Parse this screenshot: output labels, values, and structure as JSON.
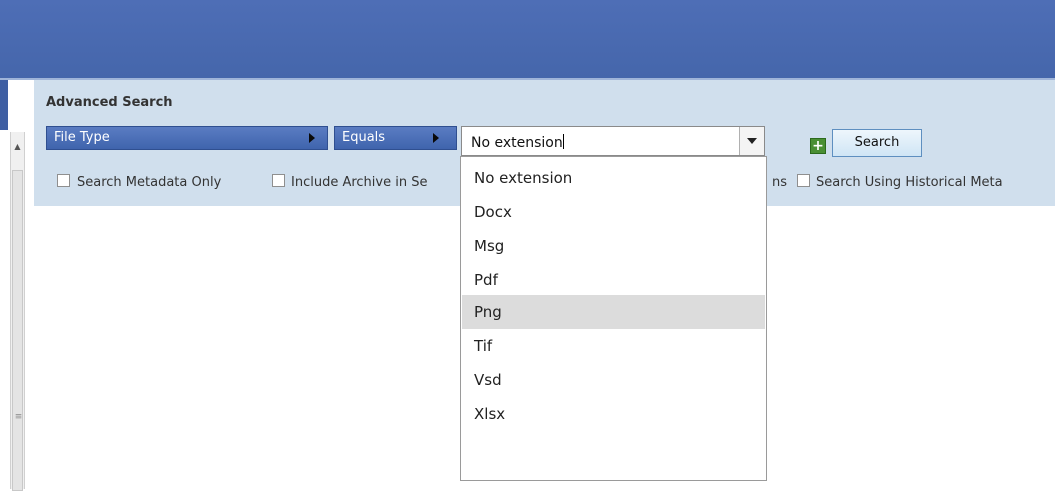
{
  "header": {
    "title": "Advanced Search"
  },
  "criteria": {
    "field_label": "File Type",
    "operator_label": "Equals",
    "value": "No extension",
    "add_symbol": "+",
    "search_label": "Search"
  },
  "options": [
    {
      "label": "Search Metadata Only",
      "checked": false
    },
    {
      "label": "Include Archive in Se",
      "checked": false
    },
    {
      "label": "ns",
      "checked": false
    },
    {
      "label": "Search Using Historical Meta",
      "checked": false
    }
  ],
  "dropdown": {
    "items": [
      "No extension",
      "Docx",
      "Msg",
      "Pdf",
      "Png",
      "Tif",
      "Vsd",
      "Xlsx"
    ],
    "highlighted": "Png"
  },
  "icons": {
    "scroll_up": "scroll-up-arrow-icon",
    "scroll_grip": "scroll-grip-icon",
    "field_arrow": "arrow-right-icon",
    "dropdown_arrow": "chevron-down-icon",
    "add": "plus-icon"
  },
  "colors": {
    "header_band": "#4566ab",
    "panel_bg": "#d0dfed",
    "criteria_bg": "#4a6fb8",
    "add_button": "#4a8f34",
    "highlight": "#dcdcdc"
  }
}
